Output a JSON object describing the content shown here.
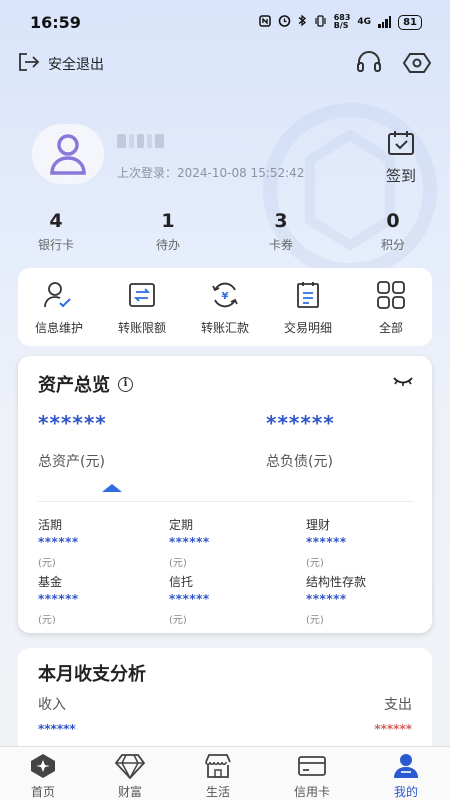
{
  "status_bar": {
    "time": "16:59",
    "net_speed_top": "683",
    "net_speed_bottom": "B/S",
    "network": "4G",
    "battery": "81"
  },
  "header": {
    "logout_label": "安全退出",
    "icons": [
      "headset-icon",
      "eye-icon"
    ]
  },
  "profile": {
    "last_login": "上次登录：2024-10-08 15:52:42",
    "sign_in_label": "签到"
  },
  "stats": [
    {
      "value": "4",
      "label": "银行卡"
    },
    {
      "value": "1",
      "label": "待办"
    },
    {
      "value": "3",
      "label": "卡券"
    },
    {
      "value": "0",
      "label": "积分"
    }
  ],
  "quick_actions": [
    {
      "label": "信息维护",
      "icon": "user-edit-icon"
    },
    {
      "label": "转账限额",
      "icon": "transfer-limit-icon"
    },
    {
      "label": "转账汇款",
      "icon": "remittance-icon"
    },
    {
      "label": "交易明细",
      "icon": "transaction-detail-icon"
    },
    {
      "label": "全部",
      "icon": "grid-icon"
    }
  ],
  "assets": {
    "title": "资产总览",
    "total_assets_value": "******",
    "total_assets_label": "总资产(元)",
    "total_liabilities_value": "******",
    "total_liabilities_label": "总负债(元)",
    "items": [
      {
        "label": "活期",
        "value": "******",
        "unit": "(元)"
      },
      {
        "label": "定期",
        "value": "******",
        "unit": "(元)"
      },
      {
        "label": "理财",
        "value": "******",
        "unit": "(元)"
      },
      {
        "label": "基金",
        "value": "******",
        "unit": "(元)"
      },
      {
        "label": "信托",
        "value": "******",
        "unit": "(元)"
      },
      {
        "label": "结构性存款",
        "value": "******",
        "unit": "(元)"
      }
    ]
  },
  "monthly": {
    "title": "本月收支分析",
    "income_label": "收入",
    "expense_label": "支出",
    "income_value": "******",
    "expense_value": "******"
  },
  "tabs": [
    {
      "label": "首页",
      "icon": "home-icon"
    },
    {
      "label": "财富",
      "icon": "diamond-icon"
    },
    {
      "label": "生活",
      "icon": "store-icon"
    },
    {
      "label": "信用卡",
      "icon": "credit-card-icon"
    },
    {
      "label": "我的",
      "icon": "person-icon",
      "active": true
    }
  ],
  "colors": {
    "accent": "#2b59d0",
    "masked_blue": "#2f55c8",
    "masked_red": "#d46060"
  }
}
